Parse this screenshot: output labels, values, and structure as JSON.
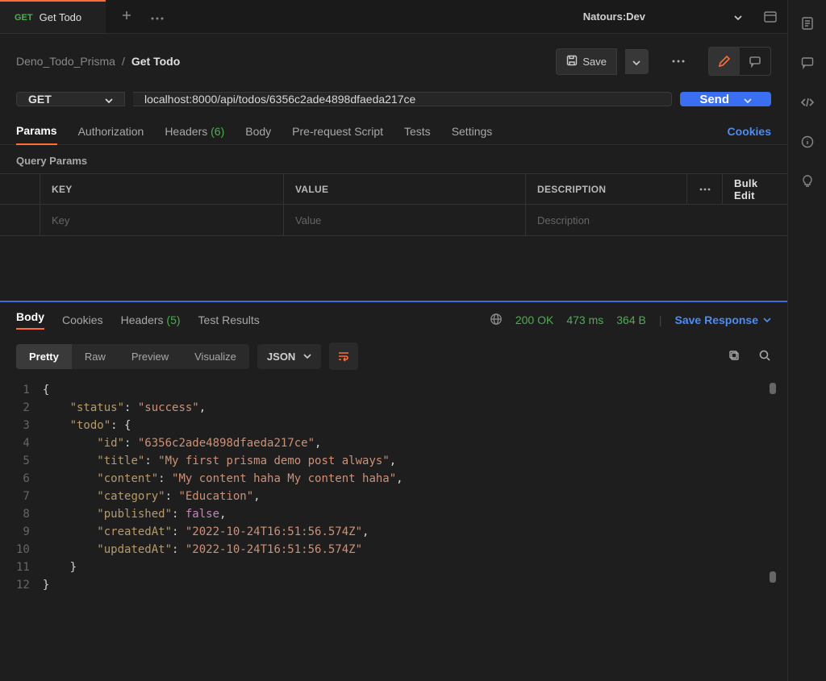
{
  "tab": {
    "method": "GET",
    "title": "Get Todo"
  },
  "env": {
    "name": "Natours:Dev"
  },
  "breadcrumb": {
    "parent": "Deno_Todo_Prisma",
    "sep": "/",
    "current": "Get Todo"
  },
  "save": {
    "label": "Save"
  },
  "request": {
    "method": "GET",
    "url": "localhost:8000/api/todos/6356c2ade4898dfaeda217ce",
    "send": "Send"
  },
  "req_tabs": {
    "params": "Params",
    "authorization": "Authorization",
    "headers": "Headers",
    "headers_count": "(6)",
    "body": "Body",
    "prerequest": "Pre-request Script",
    "tests": "Tests",
    "settings": "Settings",
    "cookies": "Cookies"
  },
  "query_params_label": "Query Params",
  "params_table": {
    "key_h": "KEY",
    "val_h": "VALUE",
    "desc_h": "DESCRIPTION",
    "bulk": "Bulk Edit",
    "key_ph": "Key",
    "val_ph": "Value",
    "desc_ph": "Description"
  },
  "resp_tabs": {
    "body": "Body",
    "cookies": "Cookies",
    "headers": "Headers",
    "headers_count": "(5)",
    "test_results": "Test Results"
  },
  "resp_status": {
    "status": "200 OK",
    "time": "473 ms",
    "size": "364 B",
    "save_response": "Save Response"
  },
  "resp_view": {
    "pretty": "Pretty",
    "raw": "Raw",
    "preview": "Preview",
    "visualize": "Visualize",
    "format": "JSON"
  },
  "response_body": {
    "status": "success",
    "todo": {
      "id": "6356c2ade4898dfaeda217ce",
      "title": "My first prisma demo post always",
      "content": "My content haha My content haha",
      "category": "Education",
      "published": false,
      "createdAt": "2022-10-24T16:51:56.574Z",
      "updatedAt": "2022-10-24T16:51:56.574Z"
    }
  },
  "code_lines": [
    1,
    2,
    3,
    4,
    5,
    6,
    7,
    8,
    9,
    10,
    11,
    12
  ]
}
